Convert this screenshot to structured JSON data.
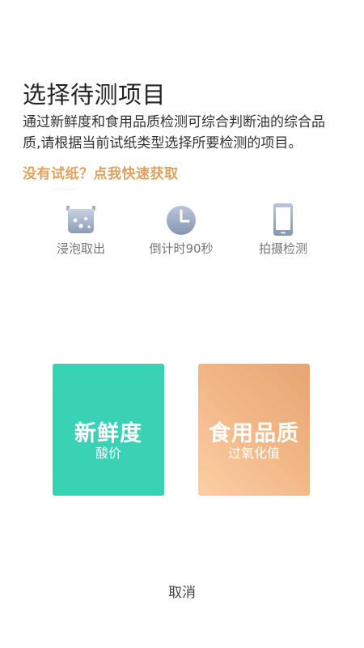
{
  "header": {
    "title": "选择待测项目",
    "description": "通过新鲜度和食用品质检测可综合判断油的综合品质,请根据当前试纸类型选择所要检测的项目。",
    "quick_link": "没有试纸？点我快速获取"
  },
  "steps": [
    {
      "label": "浸泡取出",
      "icon": "beaker-icon"
    },
    {
      "label": "倒计时90秒",
      "icon": "clock-icon"
    },
    {
      "label": "拍摄检测",
      "icon": "phone-icon"
    }
  ],
  "cards": {
    "fresh": {
      "title": "新鲜度",
      "subtitle": "酸价",
      "color": "#3AD2B4"
    },
    "quality": {
      "title": "食用品质",
      "subtitle": "过氧化值",
      "color": "#F2B787"
    }
  },
  "cancel_label": "取消",
  "colors": {
    "accent_orange": "#E0A25F",
    "icon_gray": "#9AA6BD"
  }
}
